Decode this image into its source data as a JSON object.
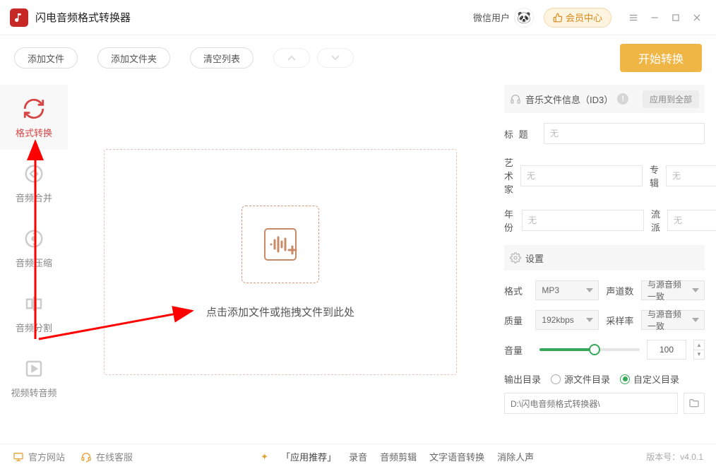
{
  "app": {
    "title": "闪电音频格式转换器"
  },
  "titlebar": {
    "wechat_user": "微信用户",
    "member_center": "会员中心"
  },
  "toolbar": {
    "add_file": "添加文件",
    "add_folder": "添加文件夹",
    "clear_list": "清空列表",
    "start": "开始转换"
  },
  "sidebar": {
    "items": [
      {
        "label": "格式转换"
      },
      {
        "label": "音频合并"
      },
      {
        "label": "音频压缩"
      },
      {
        "label": "音频分割"
      },
      {
        "label": "视频转音频"
      }
    ]
  },
  "dropzone": {
    "hint": "点击添加文件或拖拽文件到此处"
  },
  "id3": {
    "section_title": "音乐文件信息（ID3）",
    "apply_all": "应用到全部",
    "title_label": "标 题",
    "artist_label": "艺术家",
    "album_label": "专辑",
    "year_label": "年 份",
    "genre_label": "流派",
    "placeholder": "无"
  },
  "settings": {
    "section_title": "设置",
    "format_label": "格式",
    "format_value": "MP3",
    "channels_label": "声道数",
    "channels_value": "与源音频一致",
    "quality_label": "质量",
    "quality_value": "192kbps",
    "samplerate_label": "采样率",
    "samplerate_value": "与源音频一致",
    "volume_label": "音量",
    "volume_value": "100",
    "output_label": "输出目录",
    "output_source": "源文件目录",
    "output_custom": "自定义目录",
    "output_path": "D:\\闪电音频格式转换器\\"
  },
  "statusbar": {
    "official_site": "官方网站",
    "online_service": "在线客服",
    "app_recommend": "「应用推荐」",
    "record": "录音",
    "audio_edit": "音频剪辑",
    "tts": "文字语音转换",
    "denoise": "消除人声",
    "version_label": "版本号：",
    "version": "v4.0.1"
  }
}
